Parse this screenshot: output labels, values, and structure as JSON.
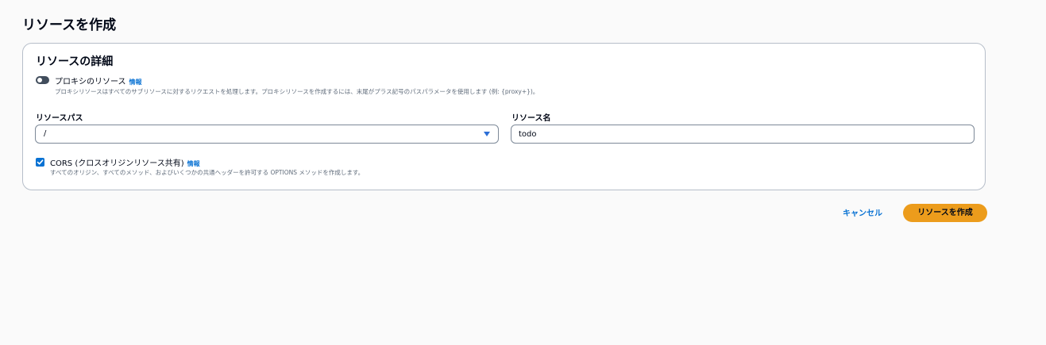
{
  "page": {
    "title": "リソースを作成"
  },
  "details": {
    "title": "リソースの詳細",
    "proxy": {
      "label": "プロキシのリソース",
      "info": "情報",
      "enabled": false,
      "description": "プロキシリソースはすべてのサブリソースに対するリクエストを処理します。プロキシリソースを作成するには、末尾がプラス記号のパスパラメータを使用します (例: {proxy+})。"
    },
    "resource_path": {
      "label": "リソースパス",
      "value": "/"
    },
    "resource_name": {
      "label": "リソース名",
      "value": "todo"
    },
    "cors": {
      "label": "CORS (クロスオリジンリソース共有)",
      "info": "情報",
      "checked": true,
      "description": "すべてのオリジン、すべてのメソッド、およびいくつかの共通ヘッダーを許可する OPTIONS メソッドを作成します。"
    }
  },
  "actions": {
    "cancel_label": "キャンセル",
    "create_label": "リソースを作成"
  },
  "colors": {
    "primary_button": "#ec9c1c",
    "link": "#0972d3",
    "checkbox": "#0972d3"
  }
}
